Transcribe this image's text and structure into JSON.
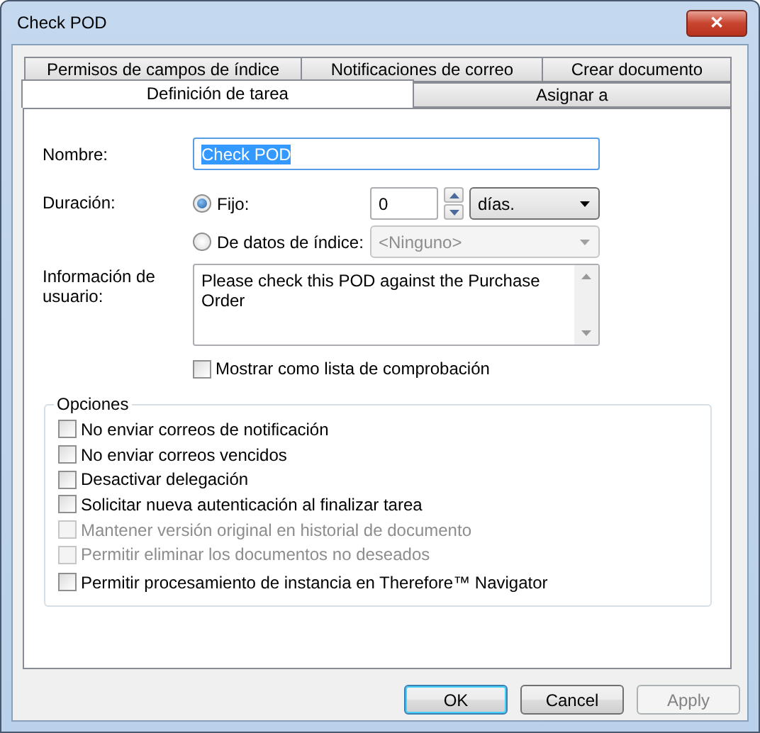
{
  "window": {
    "title": "Check POD",
    "close": "✕"
  },
  "tabs": {
    "back_row": [
      {
        "label": "Permisos de campos de índice",
        "selected": false
      },
      {
        "label": "Notificaciones de correo",
        "selected": false
      },
      {
        "label": "Crear documento",
        "selected": false
      }
    ],
    "front_row": [
      {
        "label": "Definición de tarea",
        "selected": true
      },
      {
        "label": "Asignar a",
        "selected": false
      }
    ]
  },
  "name": {
    "label": "Nombre:",
    "value": "Check POD",
    "highlighted": true
  },
  "duration": {
    "label": "Duración:",
    "options": [
      {
        "kind": "fixed",
        "label": "Fijo:",
        "selected": true,
        "value": "0",
        "unit": "días."
      },
      {
        "kind": "index",
        "label": "De datos de índice:",
        "selected": false,
        "value": "<Ninguno>",
        "disabled": true
      }
    ]
  },
  "user_info": {
    "label": "Información de usuario:",
    "value": "Please check this POD against the Purchase Order"
  },
  "checklist": {
    "label": "Mostrar como lista de comprobación",
    "checked": false
  },
  "options": {
    "title": "Opciones",
    "items": [
      {
        "label": "No enviar correos de notificación",
        "checked": false,
        "disabled": false
      },
      {
        "label": "No enviar correos vencidos",
        "checked": false,
        "disabled": false
      },
      {
        "label": "Desactivar delegación",
        "checked": false,
        "disabled": false
      },
      {
        "label": "Solicitar nueva autenticación al finalizar tarea",
        "checked": false,
        "disabled": false
      },
      {
        "label": "Mantener versión original en historial de documento",
        "checked": false,
        "disabled": true
      },
      {
        "label": "Permitir eliminar los documentos no deseados",
        "checked": false,
        "disabled": true
      },
      {
        "label": "Permitir procesamiento de instancia en Therefore™ Navigator",
        "checked": false,
        "disabled": false
      }
    ]
  },
  "buttons": [
    {
      "label": "OK",
      "default": true,
      "disabled": false
    },
    {
      "label": "Cancel",
      "default": false,
      "disabled": false
    },
    {
      "label": "Apply",
      "default": false,
      "disabled": true
    }
  ]
}
